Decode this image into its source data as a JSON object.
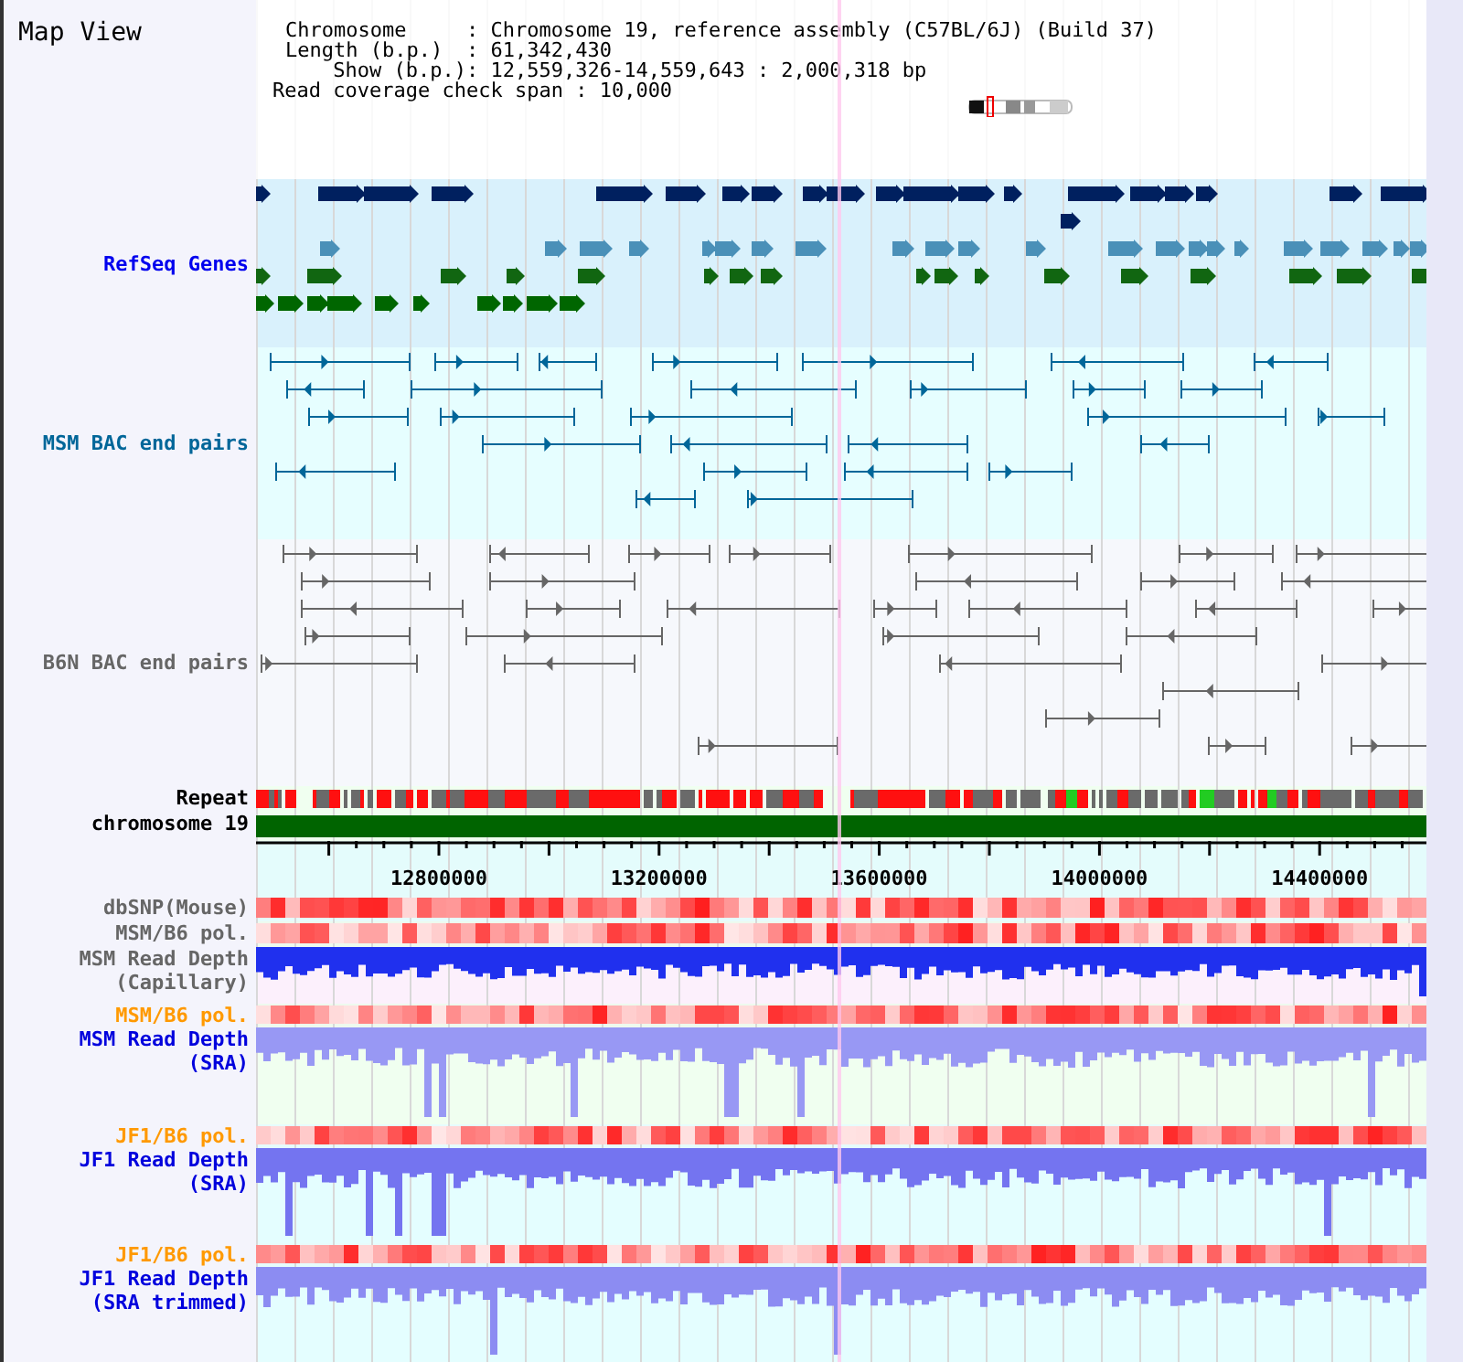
{
  "title": "Map View",
  "info": [
    {
      "key": "Chromosome",
      "value": ": Chromosome 19, reference assembly (C57BL/6J) (Build 37)"
    },
    {
      "key": "Length (b.p.)",
      "value": ": 61,342,430"
    },
    {
      "key": "Show (b.p.)",
      "value": ": 12,559,326-14,559,643 : 2,000,318 bp"
    },
    {
      "key": "Read coverage check span",
      "value": ": 10,000"
    }
  ],
  "tracks": [
    {
      "kind": "genes",
      "label": "RefSeq Genes",
      "color": "#0000ee"
    },
    {
      "kind": "pairs",
      "label": "MSM BAC end pairs",
      "color": "#006699"
    },
    {
      "kind": "pairs",
      "label": "B6N BAC end pairs",
      "color": "#666666"
    },
    {
      "kind": "repeat",
      "label": "Repeat",
      "color": "#000000"
    },
    {
      "kind": "chromosome",
      "label": "chromosome 19",
      "color": "#000000"
    },
    {
      "kind": "axis",
      "ticks": [
        "12800000",
        "13200000",
        "13600000",
        "14000000",
        "14400000"
      ]
    },
    {
      "kind": "snp",
      "label": "dbSNP(Mouse)",
      "color": "#666666"
    },
    {
      "kind": "snp",
      "label": "MSM/B6 pol.",
      "color": "#666666"
    },
    {
      "kind": "depth",
      "label": "MSM Read Depth\n(Capillary)",
      "color": "#666666"
    },
    {
      "kind": "snp",
      "label": "MSM/B6 pol.",
      "color": "#ff9900"
    },
    {
      "kind": "depth",
      "label": "MSM Read Depth\n(SRA)",
      "color": "#0000dd"
    },
    {
      "kind": "snp",
      "label": "JF1/B6 pol.",
      "color": "#ff9900"
    },
    {
      "kind": "depth",
      "label": "JF1 Read Depth\n(SRA)",
      "color": "#0000dd"
    },
    {
      "kind": "snp",
      "label": "JF1/B6 pol.",
      "color": "#ff9900"
    },
    {
      "kind": "depth",
      "label": "JF1 Read Depth\n(SRA trimmed)",
      "color": "#0000dd"
    }
  ]
}
